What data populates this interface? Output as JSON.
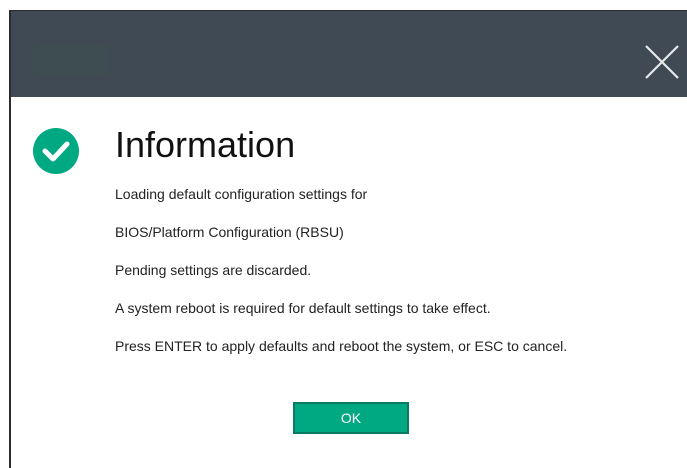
{
  "dialog": {
    "title": "Information",
    "status_icon": "check-circle-icon",
    "close_icon": "close-icon",
    "messages": [
      "Loading default configuration settings for",
      "BIOS/Platform Configuration (RBSU)",
      "Pending settings are discarded.",
      "A system reboot is required for default settings to take effect.",
      "Press ENTER to apply defaults and reboot the system, or ESC to cancel."
    ],
    "ok_label": "OK"
  },
  "colors": {
    "titlebar": "#3f4a55",
    "accent": "#01a982",
    "text": "#222222"
  }
}
